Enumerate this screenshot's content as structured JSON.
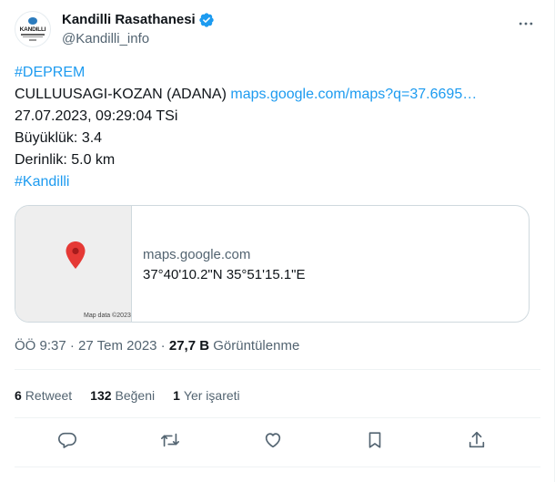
{
  "user": {
    "display_name": "Kandilli Rasathanesi",
    "handle": "@Kandilli_info",
    "avatar_text": "KANDILLI"
  },
  "tweet": {
    "hashtag_top": "#DEPREM",
    "location": "CULLUUSAGI-KOZAN (ADANA) ",
    "link": "maps.google.com/maps?q=37.6695…",
    "datetime": "27.07.2023, 09:29:04 TSi",
    "magnitude": "Büyüklük: 3.4",
    "depth": "Derinlik: 5.0 km",
    "hashtag_bottom": "#Kandilli"
  },
  "card": {
    "domain": "maps.google.com",
    "coordinates": "37°40'10.2\"N 35°51'15.1\"E",
    "map_attribution": "Map data ©2023"
  },
  "meta": {
    "time": "ÖÖ 9:37",
    "separator1": " · ",
    "date": "27 Tem 2023",
    "separator2": " · ",
    "views_count": "27,7 B",
    "views_label": " Görüntülenme"
  },
  "stats": {
    "retweets_count": "6",
    "retweets_label": "Retweet",
    "likes_count": "132",
    "likes_label": "Beğeni",
    "bookmarks_count": "1",
    "bookmarks_label": "Yer işareti"
  },
  "icons": {
    "more": "more-icon",
    "reply": "reply-icon",
    "retweet": "retweet-icon",
    "like": "heart-icon",
    "bookmark": "bookmark-icon",
    "share": "share-icon",
    "verified": "verified-badge-icon",
    "pin": "map-pin-icon"
  },
  "colors": {
    "link": "#1d9bf0",
    "secondary_text": "#536471",
    "primary_text": "#0f1419",
    "pin": "#e53935"
  }
}
